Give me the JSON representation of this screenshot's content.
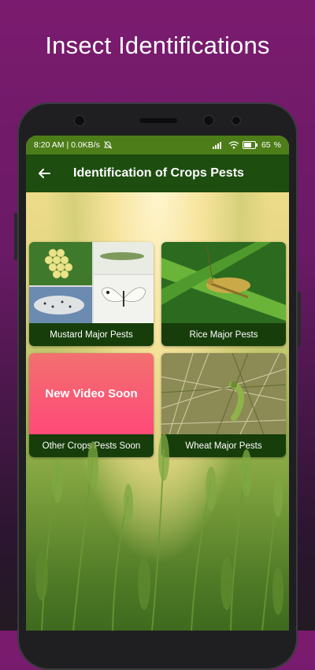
{
  "promo": {
    "title": "Insect Identifications"
  },
  "status_bar": {
    "time_speed": "8:20 AM | 0.0KB/s",
    "battery": "65"
  },
  "app_bar": {
    "title": "Identification of Crops Pests",
    "back_icon": "arrow-left-icon"
  },
  "cards": [
    {
      "label": "Mustard Major Pests"
    },
    {
      "label": "Rice Major Pests"
    },
    {
      "label": "Other Crops Pests Soon",
      "overlay_text": "New Video Soon"
    },
    {
      "label": "Wheat Major Pests"
    }
  ],
  "colors": {
    "status_bar": "#4d7d19",
    "app_bar": "#1e4d10",
    "card_label": "#173d0b",
    "promo_bg": "#7b1b6f",
    "soon_gradient_top": "#f2706f",
    "soon_gradient_bottom": "#ff4a78"
  }
}
